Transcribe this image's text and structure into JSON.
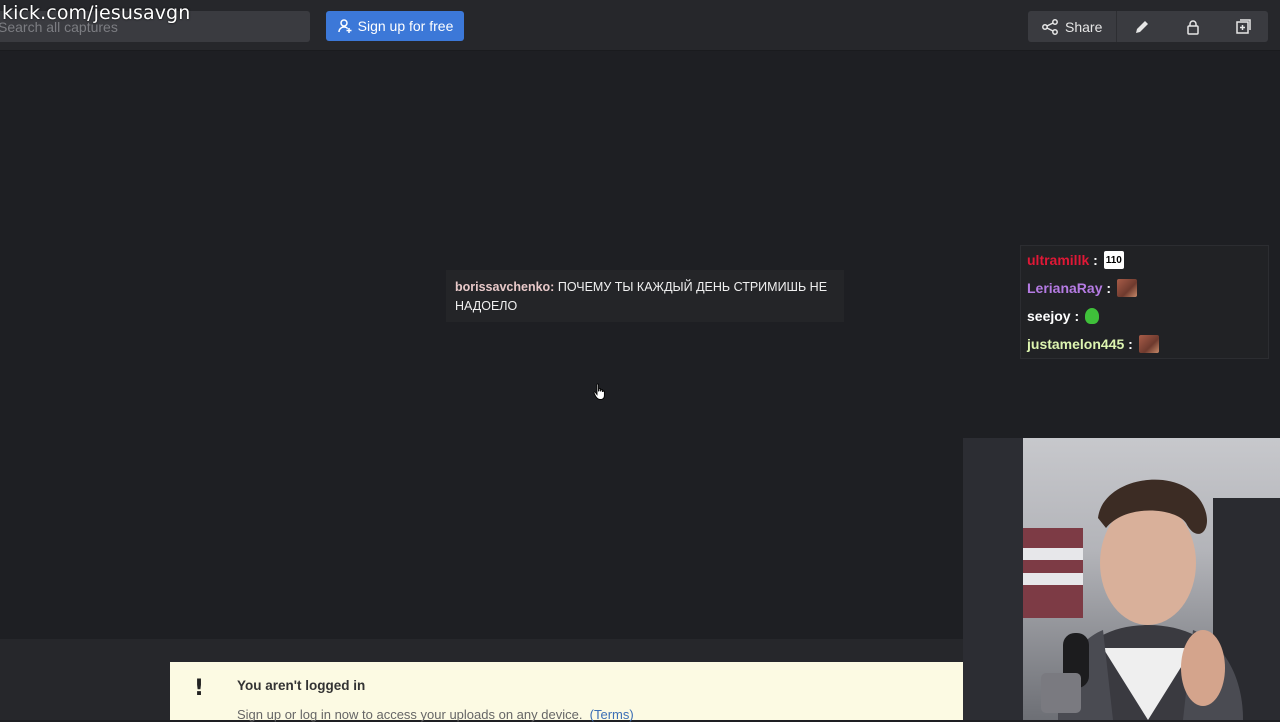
{
  "watermark": "kick.com/jesusavgn",
  "search": {
    "placeholder": "Search all captures",
    "value": ""
  },
  "header": {
    "signup_label": "Sign up for free",
    "share_label": "Share"
  },
  "icons": {
    "signup": "user-plus-icon",
    "share": "share-icon",
    "edit": "pencil-icon",
    "lock": "lock-icon",
    "new": "add-window-icon",
    "cursor": "hand-cursor-icon",
    "notice": "exclamation-icon"
  },
  "capture": {
    "message_user": "borissavchenko:",
    "message_text": "ПОЧЕМУ ТЫ КАЖДЫЙ ДЕНЬ СТРИМИШЬ НЕ НАДОЕЛО"
  },
  "chat_overlay": [
    {
      "user": "ultramillk",
      "color": "#e01836",
      "sep": ":",
      "emote": "110"
    },
    {
      "user": "LerianaRay",
      "color": "#b57be3",
      "sep": ":",
      "emote": "face"
    },
    {
      "user": "seejoy",
      "color": "#ffffff",
      "sep": ":",
      "emote": "green"
    },
    {
      "user": "justamelon445",
      "color": "#ddf5b0",
      "sep": ":",
      "emote": "face"
    }
  ],
  "notice": {
    "title": "You aren't logged in",
    "text": "Sign up or log in now to access your uploads on any device.",
    "link": "(Terms)"
  },
  "colors": {
    "accent": "#3c78d8",
    "notice_bg": "#fcfae3",
    "background": "#1e1f23"
  }
}
